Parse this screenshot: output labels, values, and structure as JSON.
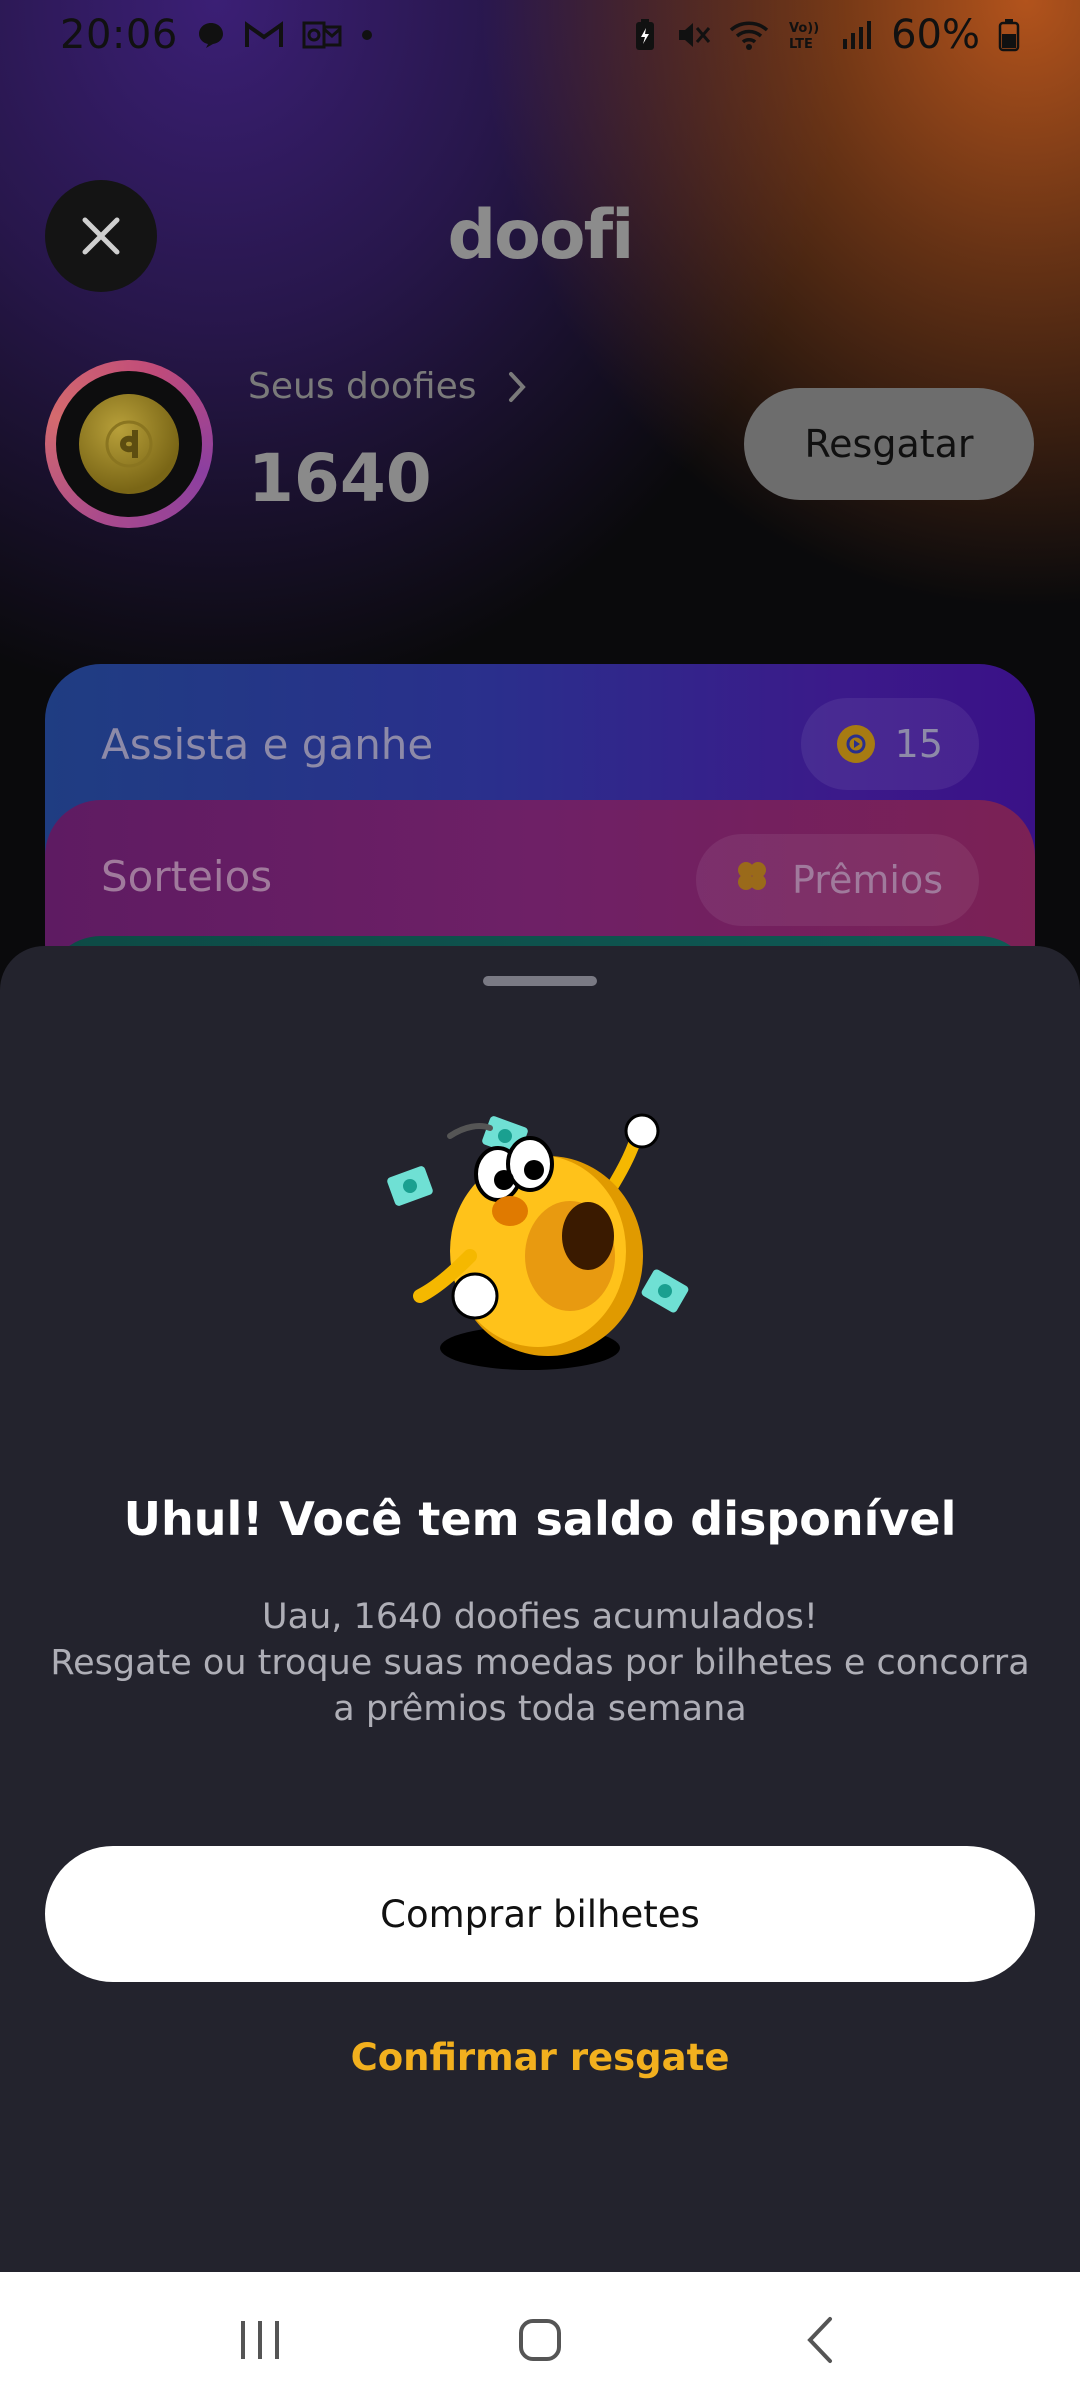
{
  "status_bar": {
    "time": "20:06",
    "battery": "60%",
    "left_icons": [
      "chat-bubble-icon",
      "gmail-icon",
      "outlook-icon",
      "dot-icon"
    ],
    "right_icons": [
      "battery-saver-icon",
      "mute-icon",
      "wifi-icon",
      "volte-icon",
      "signal-icon",
      "battery-icon"
    ]
  },
  "header": {
    "logo": "doofi",
    "close_icon": "close-icon"
  },
  "balance": {
    "label": "Seus doofies",
    "value": "1640",
    "redeem_label": "Resgatar"
  },
  "cards": {
    "watch": {
      "title": "Assista e ganhe",
      "chip_value": "15"
    },
    "raffle": {
      "title": "Sorteios",
      "chip_label": "Prêmios"
    }
  },
  "sheet": {
    "title": "Uhul! Você tem saldo disponível",
    "body_line1": "Uau, 1640 doofies acumulados!",
    "body_line2": "Resgate ou troque suas moedas por bilhetes e concorra",
    "body_line3": "a prêmios toda semana",
    "primary_button": "Comprar bilhetes",
    "secondary_button": "Confirmar resgate"
  },
  "colors": {
    "accent": "#f2b01e",
    "sheet_bg": "#23232d"
  }
}
